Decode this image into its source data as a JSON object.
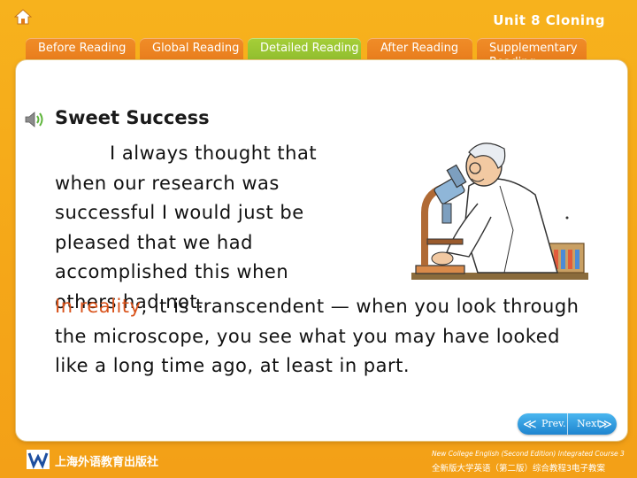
{
  "header": {
    "unit_title": "Unit 8 Cloning",
    "home_icon": "home-icon"
  },
  "tabs": [
    {
      "label": "Before Reading",
      "active": false
    },
    {
      "label": "Global Reading",
      "active": false
    },
    {
      "label": "Detailed Reading",
      "active": true
    },
    {
      "label": "After Reading",
      "active": false
    },
    {
      "label": "Supplementary Reading",
      "active": false
    }
  ],
  "content": {
    "heading": "Sweet Success",
    "para1": "I always thought that when our research was successful I would just be pleased that we had accomplished this when others had not.",
    "para2_highlight": "In reality",
    "para2_rest": ", it is transcendent — when you look through the microscope, you see what you may have looked like a long time ago, at least in part.",
    "illustration": "scientist-at-microscope"
  },
  "nav": {
    "prev_label": "Prev.",
    "next_label": "Next"
  },
  "footer": {
    "publisher": "上海外语教育出版社",
    "course_en": "New College English (Second Edition) Integrated Course 3",
    "course_zh": "全新版大学英语（第二版）综合教程3电子教案"
  },
  "colors": {
    "background": "#f5a718",
    "tab_inactive": "#e9811f",
    "tab_active": "#95c231",
    "highlight": "#d9531b",
    "nav_button": "#2b93da"
  }
}
